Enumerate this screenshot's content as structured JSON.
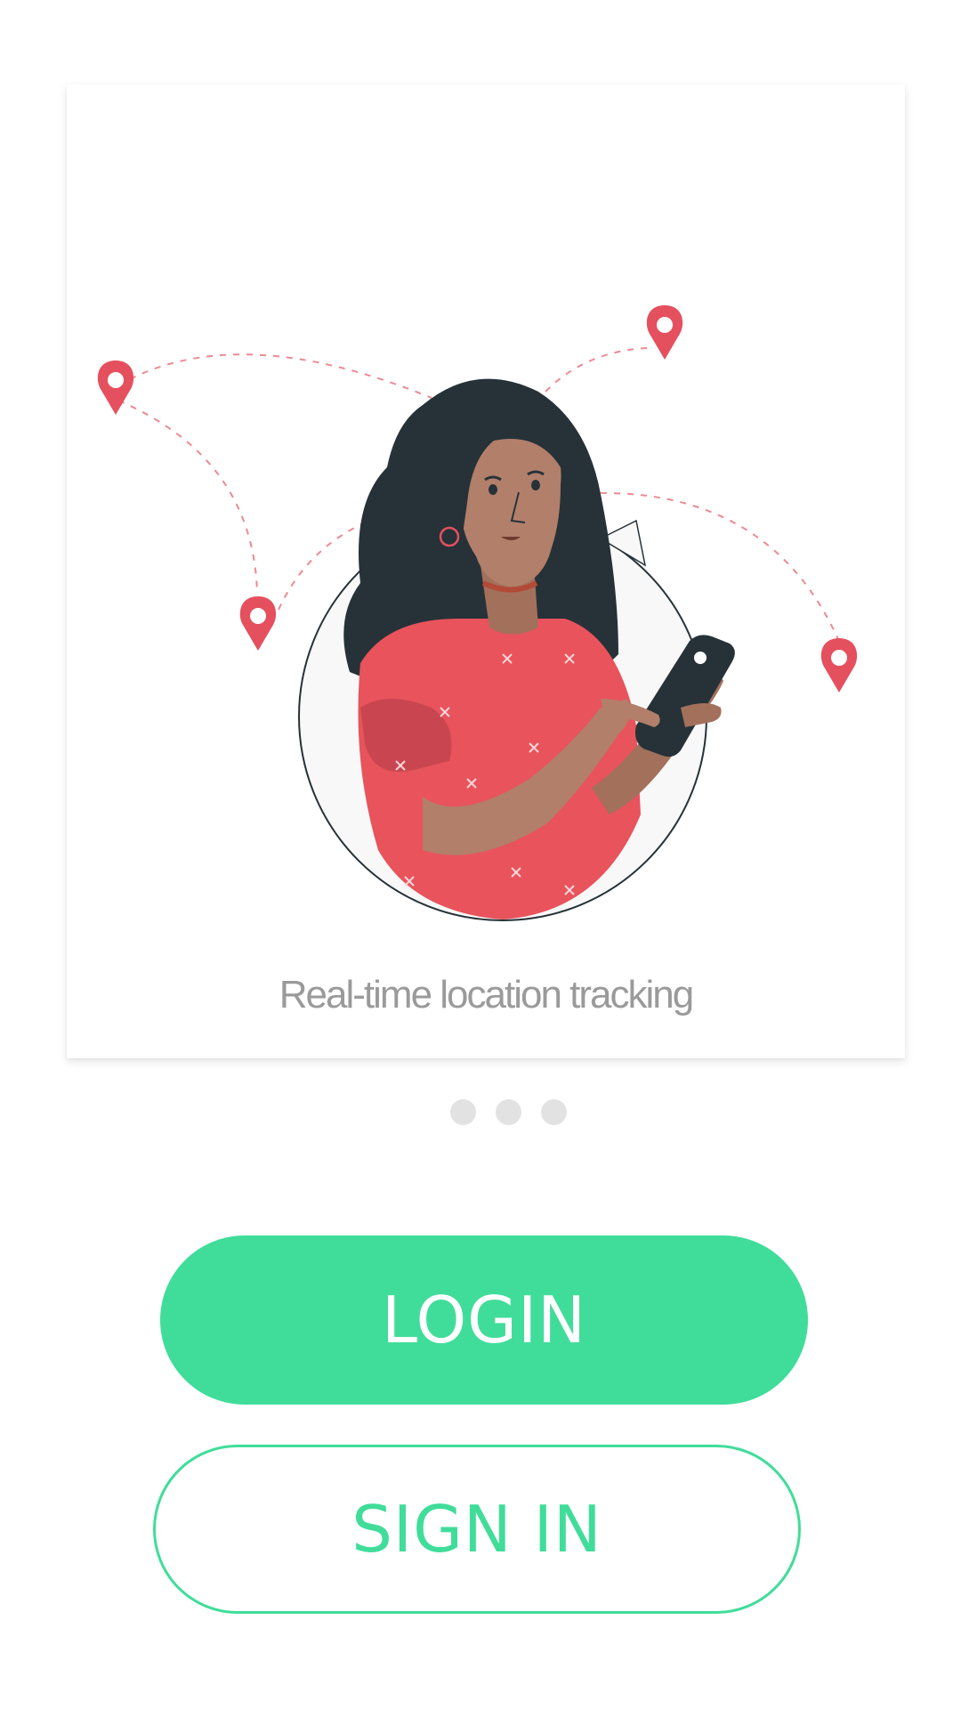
{
  "onboarding": {
    "slide_caption": "Real-time location tracking",
    "pager": {
      "count": 3,
      "active_index": 0
    }
  },
  "actions": {
    "login_label": "LOGIN",
    "signin_label": "SIGN IN"
  },
  "colors": {
    "accent": "#40dd9a",
    "pin": "#e5505e",
    "hair": "#263238",
    "shirt": "#e8535c",
    "skin": "#b27f6a",
    "caption_text": "#9a9a9a"
  },
  "illustration": {
    "subject": "woman holding smartphone with location pins",
    "icons": [
      "map-pin-icon",
      "smartphone-icon"
    ]
  }
}
